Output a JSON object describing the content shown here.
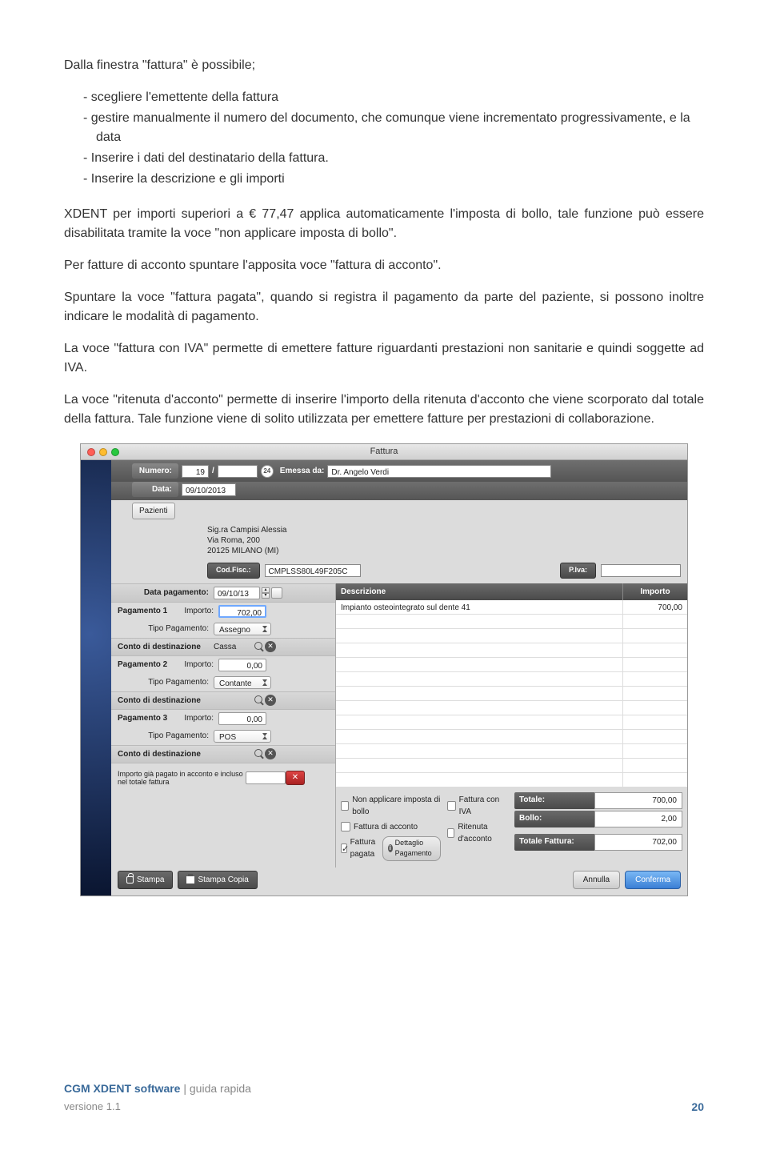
{
  "doc": {
    "intro": "Dalla finestra \"fattura\" è possibile;",
    "bullets": [
      "scegliere l'emettente della fattura",
      "gestire manualmente il numero del documento, che comunque viene incrementato progressivamente, e la data",
      "Inserire i dati del destinatario della fattura.",
      "Inserire la descrizione e gli importi"
    ],
    "p1": "XDENT per importi superiori a € 77,47 applica automaticamente l'imposta di bollo, tale funzione può essere disabilitata tramite la voce \"non applicare imposta di bollo\".",
    "p2": "Per fatture di acconto spuntare l'apposita voce \"fattura di acconto\".",
    "p3": "Spuntare la voce \"fattura pagata\", quando si registra il pagamento da parte del paziente, si possono inoltre indicare le modalità di pagamento.",
    "p4": "La voce \"fattura con IVA\" permette di emettere fatture riguardanti prestazioni non sanitarie e quindi soggette ad IVA.",
    "p5": "La voce \"ritenuta d'acconto\" permette di inserire l'importo della ritenuta d'acconto che viene scorporato dal totale della fattura. Tale funzione viene di solito utilizzata per emettere fatture per prestazioni di collaborazione."
  },
  "window": {
    "title": "Fattura",
    "numero_label": "Numero:",
    "numero_val": "19",
    "numero_sep": "/",
    "icon24": "24",
    "emessa_label": "Emessa da:",
    "emessa_val": "Dr. Angelo Verdi",
    "data_label": "Data:",
    "data_val": "09/10/2013",
    "pazienti_btn": "Pazienti",
    "patient_line1": "Sig.ra Campisi Alessia",
    "patient_line2": "Via Roma, 200",
    "patient_line3": "20125 MILANO (MI)",
    "codfisc_label": "Cod.Fisc.:",
    "codfisc_val": "CMPLSS80L49F205C",
    "piva_label": "P.Iva:"
  },
  "leftpanel": {
    "data_pag_label": "Data pagamento:",
    "data_pag_val": "09/10/13",
    "pag1_label": "Pagamento 1",
    "pag2_label": "Pagamento 2",
    "pag3_label": "Pagamento 3",
    "importo_label": "Importo:",
    "tipo_label": "Tipo Pagamento:",
    "conto_label": "Conto di destinazione",
    "p1_importo": "702,00",
    "p1_tipo": "Assegno",
    "p1_conto": "Cassa",
    "p2_importo": "0,00",
    "p2_tipo": "Contante",
    "p2_conto": "",
    "p3_importo": "0,00",
    "p3_tipo": "POS",
    "p3_conto": "",
    "already_paid": "Importo già pagato in acconto e incluso nel totale fattura"
  },
  "grid": {
    "col1": "Descrizione",
    "col2": "Importo",
    "row1_desc": "Impianto osteointegrato sul dente 41",
    "row1_val": "700,00"
  },
  "checks": {
    "c1": "Non applicare imposta di bollo",
    "c2": "Fattura di acconto",
    "c3": "Fattura pagata",
    "c4": "Fattura con IVA",
    "c5": "Ritenuta d'acconto",
    "dettaglio": "Dettaglio Pagamento"
  },
  "totals": {
    "totale_label": "Totale:",
    "totale_val": "700,00",
    "bollo_label": "Bollo:",
    "bollo_val": "2,00",
    "totfatt_label": "Totale Fattura:",
    "totfatt_val": "702,00"
  },
  "buttons": {
    "stampa": "Stampa",
    "stampa_copia": "Stampa Copia",
    "annulla": "Annulla",
    "conferma": "Conferma"
  },
  "footer": {
    "brand": "CGM XDENT software",
    "sep": " | ",
    "sub": "guida rapida",
    "version": "versione 1.1",
    "page": "20"
  }
}
